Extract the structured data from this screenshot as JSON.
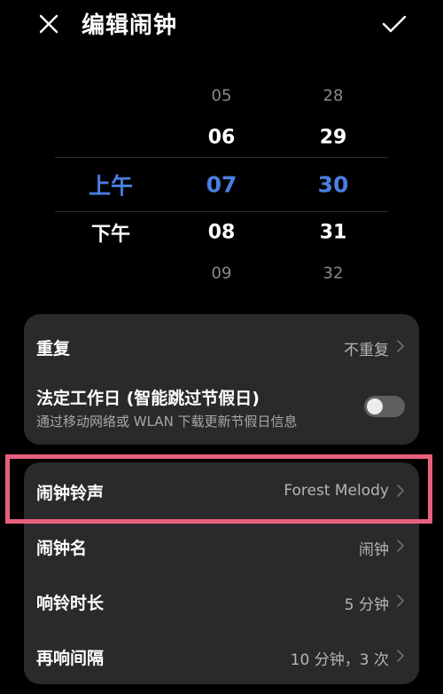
{
  "header": {
    "title": "编辑闹钟",
    "close_icon": "close-icon",
    "confirm_icon": "check-icon"
  },
  "picker": {
    "period": {
      "items": [
        "上午",
        "下午"
      ],
      "selected": "上午"
    },
    "hours": {
      "items": [
        "05",
        "06",
        "07",
        "08",
        "09"
      ],
      "selected": "07"
    },
    "minutes": {
      "items": [
        "28",
        "29",
        "30",
        "31",
        "32"
      ],
      "selected": "30"
    },
    "accent_color": "#4a7fe2"
  },
  "settings": {
    "repeat": {
      "label": "重复",
      "value": "不重复"
    },
    "workday": {
      "label": "法定工作日 (智能跳过节假日)",
      "description": "通过移动网络或 WLAN 下载更新节假日信息",
      "enabled": false
    },
    "ringtone": {
      "label": "闹钟铃声",
      "value": "Forest Melody"
    },
    "alarm_name": {
      "label": "闹钟名",
      "value": "闹钟"
    },
    "ring_duration": {
      "label": "响铃时长",
      "value": "5 分钟"
    },
    "snooze": {
      "label": "再响间隔",
      "value": "10 分钟，3 次"
    }
  },
  "annotation": {
    "highlight_color": "#e8607d"
  }
}
